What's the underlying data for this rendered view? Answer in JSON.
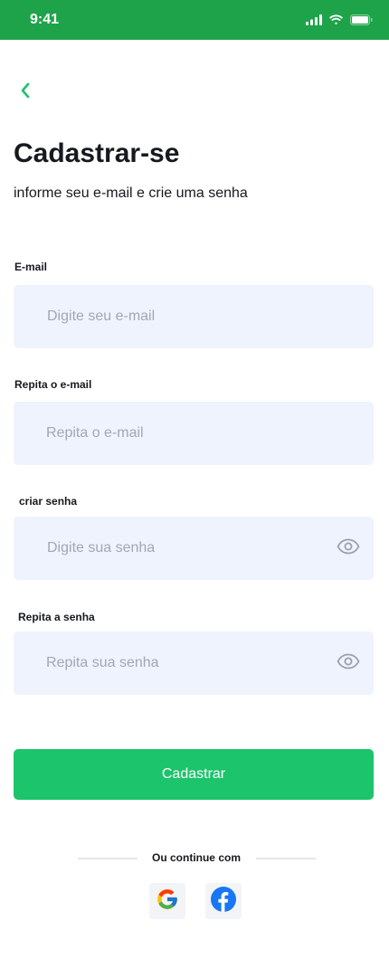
{
  "status_bar": {
    "time": "9:41",
    "color": "#1fa34a"
  },
  "header": {
    "back_icon": "chevron-left-icon",
    "title": "Cadastrar-se",
    "subtitle": "informe seu e-mail e crie uma senha"
  },
  "form": {
    "email": {
      "label": "E-mail",
      "placeholder": "Digite seu e-mail",
      "value": ""
    },
    "email_confirm": {
      "label": "Repita o e-mail",
      "placeholder": "Repita o e-mail",
      "value": ""
    },
    "password": {
      "label": "criar senha",
      "placeholder": "Digite sua senha",
      "value": "",
      "icon": "eye-icon"
    },
    "password_confirm": {
      "label": "Repita a senha",
      "placeholder": "Repita sua senha",
      "value": "",
      "icon": "eye-icon"
    },
    "field_bg": "#eff3fd"
  },
  "submit": {
    "label": "Cadastrar",
    "color": "#1cc46b"
  },
  "social": {
    "divider_text": "Ou continue com",
    "providers": [
      {
        "name": "Google",
        "icon": "google-icon"
      },
      {
        "name": "Facebook",
        "icon": "facebook-icon"
      }
    ]
  },
  "accent_color": "#1cc46b"
}
